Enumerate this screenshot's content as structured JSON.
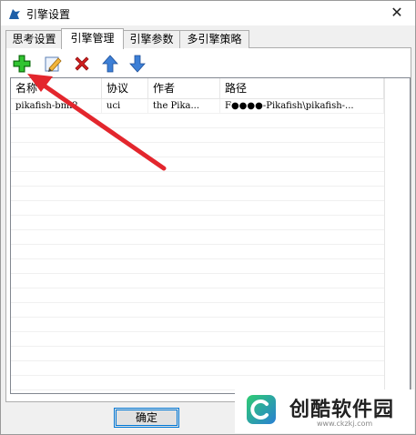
{
  "window": {
    "title": "引擎设置",
    "close_glyph": "✕"
  },
  "tabs": [
    {
      "label": "思考设置",
      "active": false
    },
    {
      "label": "引擎管理",
      "active": true
    },
    {
      "label": "引擎参数",
      "active": false
    },
    {
      "label": "多引擎策略",
      "active": false
    }
  ],
  "toolbar": {
    "buttons": [
      {
        "name": "add-engine-button",
        "icon": "plus-icon",
        "color": "#1e9e1e"
      },
      {
        "name": "edit-engine-button",
        "icon": "edit-icon",
        "color": "#4a7fd1"
      },
      {
        "name": "delete-engine-button",
        "icon": "red-x-icon",
        "color": "#d21f1f"
      },
      {
        "name": "move-up-button",
        "icon": "arrow-up-icon",
        "color": "#3c7fd6"
      },
      {
        "name": "move-down-button",
        "icon": "arrow-down-icon",
        "color": "#3c7fd6"
      }
    ]
  },
  "table": {
    "columns": [
      "名称",
      "协议",
      "作者",
      "路径"
    ],
    "rows": [
      [
        "pikafish-bmi2",
        "uci",
        "the Pika...",
        "F●●●●-Pikafish\\pikafish-..."
      ]
    ]
  },
  "dialog": {
    "ok_label": "确定"
  },
  "annotation": {
    "color": "#e3262d"
  },
  "watermark": {
    "name": "创酷软件园",
    "url": "www.ckzkj.com"
  }
}
